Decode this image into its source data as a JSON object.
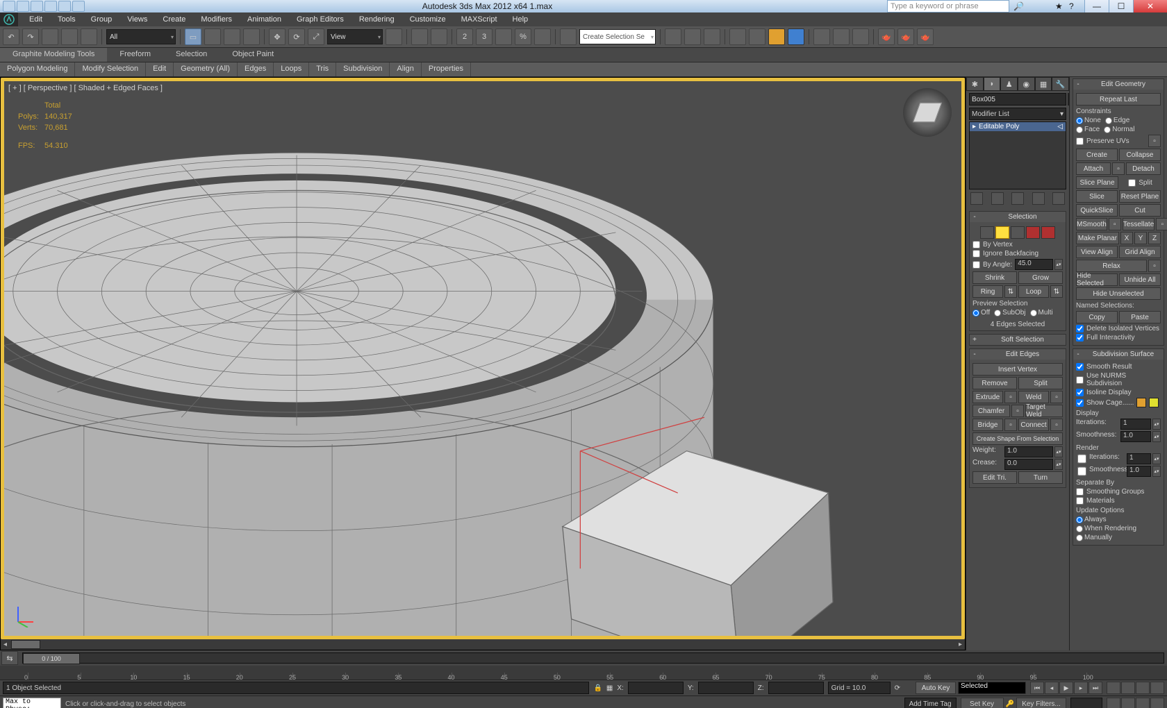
{
  "app": {
    "title": "Autodesk 3ds Max 2012 x64     1.max",
    "search_placeholder": "Type a keyword or phrase"
  },
  "menus": [
    "Edit",
    "Tools",
    "Group",
    "Views",
    "Create",
    "Modifiers",
    "Animation",
    "Graph Editors",
    "Rendering",
    "Customize",
    "MAXScript",
    "Help"
  ],
  "toolbar": {
    "all": "All",
    "view": "View",
    "selset": "Create Selection Se"
  },
  "ribbon_tabs": [
    "Graphite Modeling Tools",
    "Freeform",
    "Selection",
    "Object Paint"
  ],
  "ribbon_sub": [
    "Polygon Modeling",
    "Modify Selection",
    "Edit",
    "Geometry (All)",
    "Edges",
    "Loops",
    "Tris",
    "Subdivision",
    "Align",
    "Properties"
  ],
  "viewport": {
    "label": "[ + ] [ Perspective ] [ Shaded + Edged Faces ]",
    "stats": {
      "total": "Total",
      "polys_label": "Polys:",
      "polys": "140,317",
      "verts_label": "Verts:",
      "verts": "70,681",
      "fps_label": "FPS:",
      "fps": "54.310"
    },
    "slider": "0 / 100"
  },
  "modify": {
    "object": "Box005",
    "modifier_list": "Modifier List",
    "stack_item": "Editable Poly",
    "selection": {
      "title": "Selection",
      "by_vertex": "By Vertex",
      "ignore_back": "Ignore Backfacing",
      "by_angle": "By Angle:",
      "angle": "45.0",
      "shrink": "Shrink",
      "grow": "Grow",
      "ring": "Ring",
      "loop": "Loop",
      "preview": "Preview Selection",
      "off": "Off",
      "subobj": "SubObj",
      "multi": "Multi",
      "status": "4 Edges Selected"
    },
    "soft_selection": "Soft Selection",
    "edit_edges": {
      "title": "Edit Edges",
      "insert_vertex": "Insert Vertex",
      "remove": "Remove",
      "split": "Split",
      "extrude": "Extrude",
      "weld": "Weld",
      "chamfer": "Chamfer",
      "target_weld": "Target Weld",
      "bridge": "Bridge",
      "connect": "Connect",
      "create_shape": "Create Shape From Selection",
      "weight": "Weight:",
      "weight_val": "1.0",
      "crease": "Crease:",
      "crease_val": "0.0",
      "edit_tri": "Edit Tri.",
      "turn": "Turn"
    }
  },
  "edit_geom": {
    "title": "Edit Geometry",
    "repeat": "Repeat Last",
    "constraints": "Constraints",
    "none": "None",
    "edge": "Edge",
    "face": "Face",
    "normal": "Normal",
    "preserve_uvs": "Preserve UVs",
    "create": "Create",
    "collapse": "Collapse",
    "attach": "Attach",
    "detach": "Detach",
    "slice_plane": "Slice Plane",
    "split": "Split",
    "slice": "Slice",
    "reset_plane": "Reset Plane",
    "quickslice": "QuickSlice",
    "cut": "Cut",
    "msmooth": "MSmooth",
    "tessellate": "Tessellate",
    "make_planar": "Make Planar",
    "x": "X",
    "y": "Y",
    "z": "Z",
    "view_align": "View Align",
    "grid_align": "Grid Align",
    "relax": "Relax",
    "hide_sel": "Hide Selected",
    "unhide": "Unhide All",
    "hide_unsel": "Hide Unselected",
    "named_sel": "Named Selections:",
    "copy": "Copy",
    "paste": "Paste",
    "del_iso": "Delete Isolated Vertices",
    "full_inter": "Full Interactivity"
  },
  "subdiv": {
    "title": "Subdivision Surface",
    "smooth_result": "Smooth Result",
    "use_nurms": "Use NURMS Subdivision",
    "isoline": "Isoline Display",
    "show_cage": "Show Cage......",
    "display": "Display",
    "iterations": "Iterations:",
    "iter_val": "1",
    "smoothness": "Smoothness:",
    "smooth_val": "1.0",
    "render": "Render",
    "r_iter_val": "1",
    "r_smooth_val": "1.0",
    "separate": "Separate By",
    "sm_groups": "Smoothing Groups",
    "materials": "Materials",
    "update": "Update Options",
    "always": "Always",
    "when_render": "When Rendering",
    "manually": "Manually"
  },
  "status": {
    "sel_count": "1 Object Selected",
    "x": "X:",
    "y": "Y:",
    "z": "Z:",
    "grid": "Grid = 10.0",
    "autokey": "Auto Key",
    "selected": "Selected",
    "setkey": "Set Key",
    "keyfilters": "Key Filters...",
    "script": "Max to Physc:",
    "prompt": "Click or click-and-drag to select objects",
    "timetag": "Add Time Tag"
  },
  "ticks": [
    0,
    5,
    10,
    15,
    20,
    25,
    30,
    35,
    40,
    45,
    50,
    55,
    60,
    65,
    70,
    75,
    80,
    85,
    90,
    95,
    100
  ]
}
